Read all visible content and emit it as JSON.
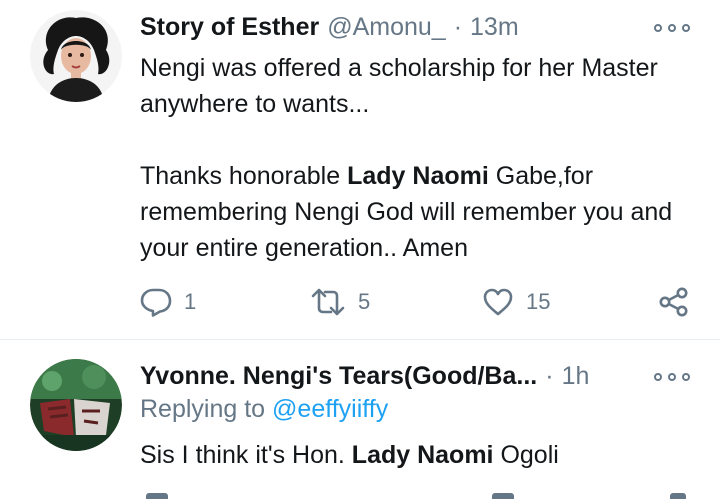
{
  "tweet1": {
    "name": "Story of Esther",
    "handle": "@Amonu_",
    "separator": "·",
    "time": "13m",
    "body_line1": "Nengi was offered a scholarship for her Master anywhere to wants...",
    "body_p2_prefix": "Thanks honorable ",
    "body_p2_bold": "Lady Naomi",
    "body_p2_suffix": " Gabe,for remembering Nengi God will remember you and your entire generation.. Amen",
    "reply_count": "1",
    "retweet_count": "5",
    "like_count": "15",
    "icons": [
      "more-icon",
      "reply-icon",
      "retweet-icon",
      "like-icon",
      "share-icon"
    ]
  },
  "tweet2": {
    "name": "Yvonne. Nengi's Tears(Good/Ba...",
    "separator": "·",
    "time": "1h",
    "replying_label": "Replying to ",
    "replying_handle": "@eeffyiiffy",
    "body_prefix": "Sis I think it's Hon. ",
    "body_bold": "Lady Naomi",
    "body_suffix": " Ogoli"
  },
  "colors": {
    "text": "#14171a",
    "secondary": "#657786",
    "link": "#1da1f2",
    "divider": "#e6ecf0"
  }
}
